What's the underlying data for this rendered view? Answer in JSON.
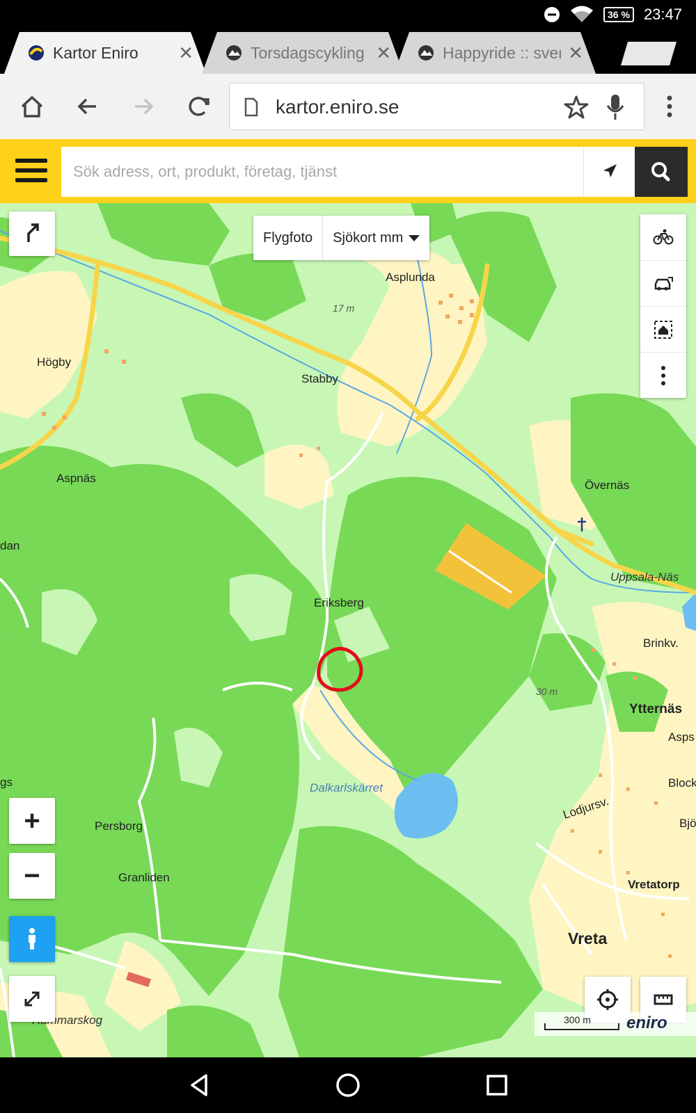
{
  "status_bar": {
    "battery": "36 %",
    "time": "23:47"
  },
  "tabs": [
    {
      "title": "Kartor Eniro",
      "active": true
    },
    {
      "title": "Torsdagscykling",
      "active": false
    },
    {
      "title": "Happyride :: sver",
      "active": false
    }
  ],
  "browser": {
    "url": "kartor.eniro.se"
  },
  "search": {
    "placeholder": "Sök adress, ort, produkt, företag, tjänst"
  },
  "map": {
    "layers": {
      "aerial": "Flygfoto",
      "sea_chart": "Sjökort mm"
    },
    "zoom_in": "+",
    "zoom_out": "−",
    "places": {
      "asplunda": "Asplunda",
      "hogby": "Högby",
      "stabby": "Stabby",
      "aspnas": "Aspnäs",
      "overnas": "Övernäs",
      "dan": "dan",
      "uppsala_nas": "Uppsala-Näs",
      "eriksberg": "Eriksberg",
      "brinkv": "Brinkv.",
      "ytternas": "Ytternäs",
      "asps": "Asps",
      "block": "Block",
      "dalkarlskarret": "Dalkarlskärret",
      "lodjursv": "Lodjursv.",
      "bjo": "Bjö",
      "persborg": "Persborg",
      "granliden": "Granliden",
      "vretatorp": "Vretatorp",
      "vreta": "Vreta",
      "hammarskog": "Hammarskog",
      "gs": "gs"
    },
    "elevations": {
      "e17": "17 m",
      "e30": "30 m"
    },
    "scale": "300 m",
    "brand": "eniro"
  },
  "colors": {
    "eniro_yellow": "#ffd11a",
    "forest": "#78d957",
    "field": "#fff5c2",
    "open": "#c8f7b5",
    "road": "#f7d54a",
    "water": "#6cbef0",
    "marker": "#e0101a"
  }
}
